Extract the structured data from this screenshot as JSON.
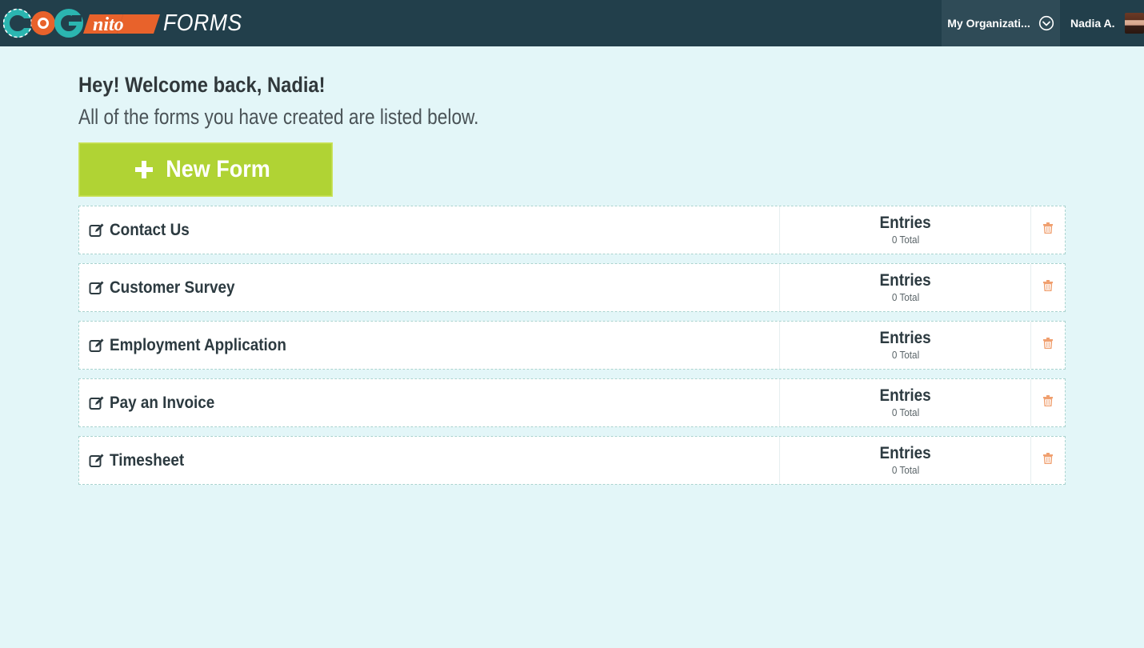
{
  "header": {
    "logo_text": "COGNITO",
    "logo_suffix": "FORMS",
    "org_menu_label": "My Organizati...",
    "user_name": "Nadia A."
  },
  "main": {
    "welcome": "Hey! Welcome back, Nadia!",
    "subtitle": "All of the forms you have created are listed below.",
    "new_form_label": "New Form",
    "forms": [
      {
        "name": "Contact Us",
        "entries_label": "Entries",
        "entries_total": "0 Total"
      },
      {
        "name": "Customer Survey",
        "entries_label": "Entries",
        "entries_total": "0 Total"
      },
      {
        "name": "Employment Application",
        "entries_label": "Entries",
        "entries_total": "0 Total"
      },
      {
        "name": "Pay an Invoice",
        "entries_label": "Entries",
        "entries_total": "0 Total"
      },
      {
        "name": "Timesheet",
        "entries_label": "Entries",
        "entries_total": "0 Total"
      }
    ]
  },
  "colors": {
    "header_bg": "#223f4b",
    "page_bg": "#e3f6f8",
    "accent_green": "#b0d334",
    "logo_teal": "#2bb5b0",
    "logo_orange": "#e8622b",
    "trash_orange": "#f0a070"
  },
  "icons": {
    "org_chevron": "chevron-circle-down-icon",
    "edit": "edit-icon",
    "delete": "trash-icon",
    "add": "plus-icon"
  }
}
